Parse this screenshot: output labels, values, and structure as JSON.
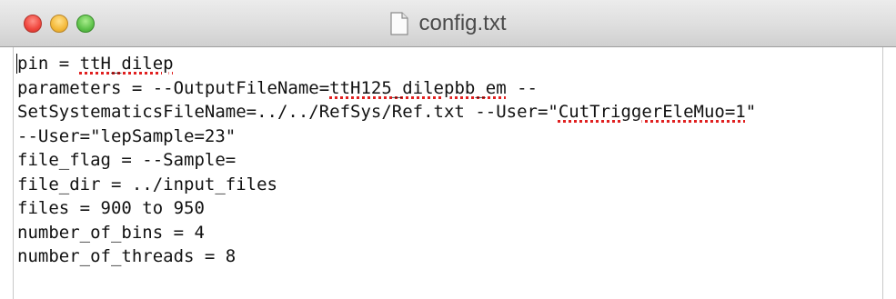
{
  "window": {
    "title": "config.txt",
    "icon": "document-icon"
  },
  "editor": {
    "lines": [
      {
        "segments": [
          {
            "text": "pin = ",
            "misspelled": false
          },
          {
            "text": "ttH_dilep",
            "misspelled": true
          }
        ]
      },
      {
        "segments": [
          {
            "text": "parameters = --OutputFileName=",
            "misspelled": false
          },
          {
            "text": "ttH125_dilepbb_em",
            "misspelled": true
          },
          {
            "text": " --",
            "misspelled": false
          }
        ]
      },
      {
        "segments": [
          {
            "text": "SetSystematicsFileName=../../RefSys/Ref.txt --User=\"",
            "misspelled": false
          },
          {
            "text": "CutTriggerEleMuo=1",
            "misspelled": true
          },
          {
            "text": "\"",
            "misspelled": false
          }
        ]
      },
      {
        "segments": [
          {
            "text": "--User=\"lepSample=23\"",
            "misspelled": false
          }
        ]
      },
      {
        "segments": [
          {
            "text": "file_flag = --Sample=",
            "misspelled": false
          }
        ]
      },
      {
        "segments": [
          {
            "text": "file_dir = ../input_files",
            "misspelled": false
          }
        ]
      },
      {
        "segments": [
          {
            "text": "files = 900 to 950",
            "misspelled": false
          }
        ]
      },
      {
        "segments": [
          {
            "text": "number_of_bins = 4",
            "misspelled": false
          }
        ]
      },
      {
        "segments": [
          {
            "text": "number_of_threads = 8",
            "misspelled": false
          }
        ]
      }
    ]
  },
  "colors": {
    "close": "#f0463d",
    "minimize": "#f4b93a",
    "zoom": "#5ec24a",
    "spellcheck_underline": "#e02020"
  }
}
